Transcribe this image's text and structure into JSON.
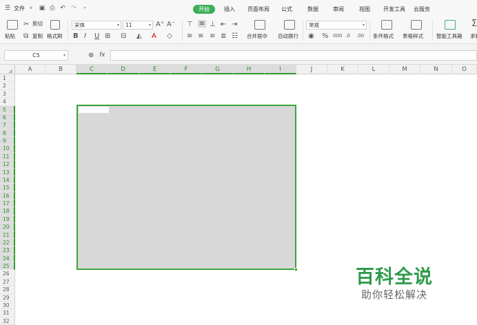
{
  "menubar": {
    "file_label": "文件",
    "tabs": [
      "开始",
      "插入",
      "页面布局",
      "公式",
      "数据",
      "审阅",
      "视图",
      "开发工具",
      "云服务"
    ],
    "active_tab": "开始"
  },
  "ribbon": {
    "paste_label": "粘贴",
    "cut_label": "剪切",
    "copy_label": "复制",
    "format_painter_label": "格式刷",
    "font_name": "宋体",
    "font_size": "11",
    "merge_center_label": "合并居中",
    "wrap_text_label": "自动换行",
    "number_format": "常规",
    "conditional_format_label": "条件格式",
    "table_style_label": "表格样式",
    "smart_toolbox_label": "智能工具箱",
    "sum_label": "求和"
  },
  "formula_bar": {
    "name_box": "C5",
    "fx_label": "fx",
    "formula": ""
  },
  "grid": {
    "columns": [
      "A",
      "B",
      "C",
      "D",
      "E",
      "F",
      "G",
      "H",
      "I",
      "J",
      "K",
      "L",
      "M",
      "N",
      "O"
    ],
    "selected_columns": [
      "C",
      "D",
      "E",
      "F",
      "G",
      "H",
      "I"
    ],
    "rows": [
      "1",
      "2",
      "3",
      "4",
      "5",
      "6",
      "7",
      "8",
      "9",
      "10",
      "11",
      "12",
      "13",
      "14",
      "15",
      "16",
      "17",
      "18",
      "19",
      "20",
      "21",
      "22",
      "23",
      "24",
      "25",
      "26",
      "27",
      "28",
      "29",
      "30",
      "31",
      "32"
    ],
    "selected_rows_from": 5,
    "selected_rows_to": 25
  },
  "watermark": {
    "main": "百科全说",
    "sub": "助你轻松解决"
  },
  "colors": {
    "accent_green": "#3cae5a",
    "selection_border": "#3aa33a",
    "selection_fill": "#d8d8d8",
    "watermark_green": "#2e9b4a"
  }
}
